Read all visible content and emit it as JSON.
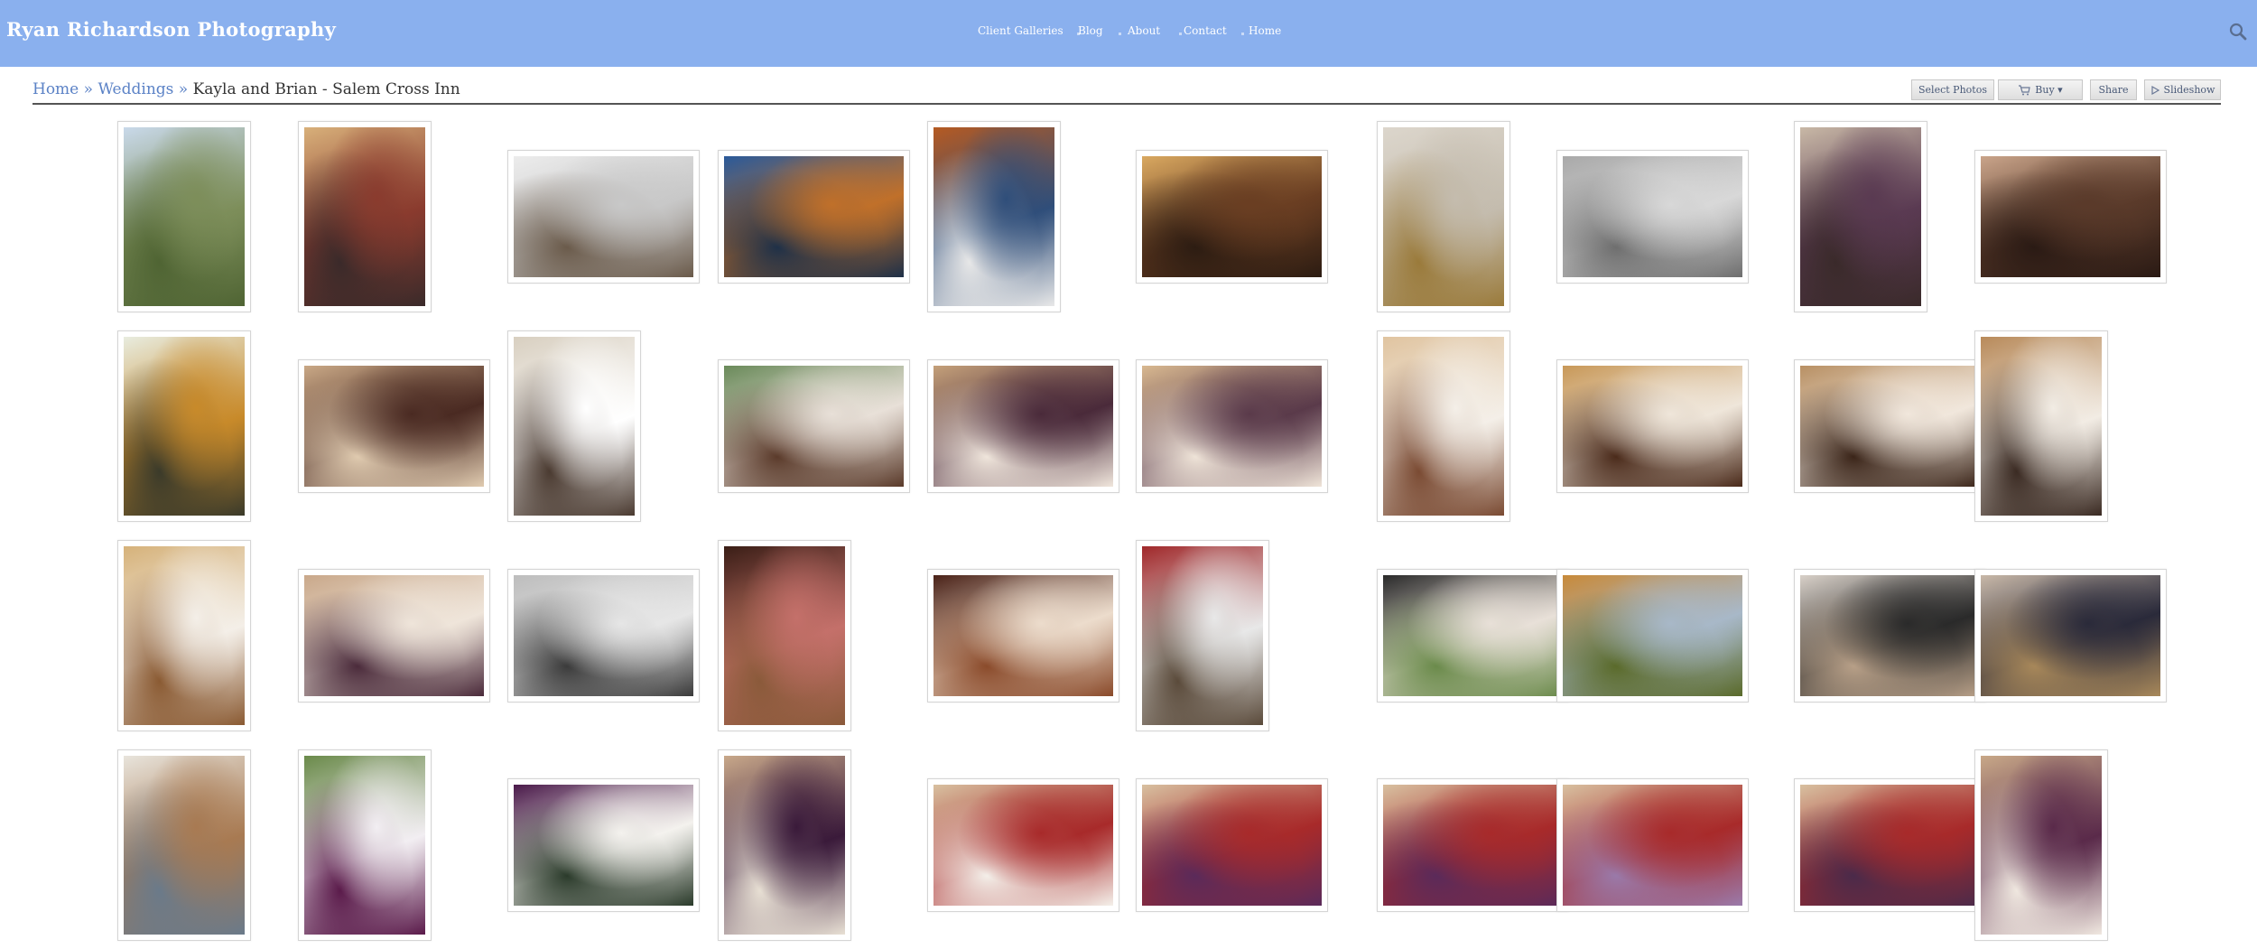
{
  "site": {
    "title": "Ryan Richardson Photography"
  },
  "nav": {
    "items": [
      {
        "label": "Client Galleries",
        "name": "nav-client-galleries"
      },
      {
        "label": "Blog",
        "name": "nav-blog"
      },
      {
        "label": "About",
        "name": "nav-about"
      },
      {
        "label": "Contact",
        "name": "nav-contact"
      },
      {
        "label": "Home",
        "name": "nav-home"
      }
    ]
  },
  "breadcrumb": {
    "home": "Home",
    "separator": "»",
    "section": "Weddings",
    "current": "Kayla and Brian - Salem Cross Inn"
  },
  "toolbar": {
    "select_label": "Select Photos",
    "buy_label": "Buy ▾",
    "share_label": "Share",
    "slideshow_label": "Slideshow"
  },
  "colors": {
    "header_bg": "#8ab0ee",
    "link": "#5b82c6",
    "thumb_border": "#d5d5d5"
  },
  "gallery": {
    "photos": [
      {
        "name": "photo-couple-field",
        "orientation": "portrait",
        "palette": [
          "#c9d9ea",
          "#7d8e5a",
          "#4f6433"
        ]
      },
      {
        "name": "photo-bride-makeup-chair",
        "orientation": "portrait",
        "palette": [
          "#d8b07a",
          "#8a3b2e",
          "#3a2a2a"
        ]
      },
      {
        "name": "photo-dress-detail",
        "orientation": "landscape",
        "palette": [
          "#ececec",
          "#c8c8c8",
          "#6a5a4a"
        ]
      },
      {
        "name": "photo-dress-by-lake",
        "orientation": "landscape",
        "palette": [
          "#2a5a9a",
          "#c0702a",
          "#1e3048"
        ]
      },
      {
        "name": "photo-dress-hanging-tree",
        "orientation": "portrait",
        "palette": [
          "#b55a22",
          "#2f4e7a",
          "#e8e8e8"
        ]
      },
      {
        "name": "photo-hair-pin",
        "orientation": "landscape",
        "palette": [
          "#d9a860",
          "#6a3e22",
          "#2c1c12"
        ]
      },
      {
        "name": "photo-necklace",
        "orientation": "portrait",
        "palette": [
          "#dcd6cc",
          "#c4bcae",
          "#9a7a3a"
        ]
      },
      {
        "name": "photo-silver-shoe",
        "orientation": "landscape",
        "palette": [
          "#a9a9a9",
          "#d8d8d8",
          "#6e6e6e"
        ]
      },
      {
        "name": "photo-braid-back",
        "orientation": "portrait",
        "palette": [
          "#c8b8a6",
          "#5a3a52",
          "#3a2a2a"
        ]
      },
      {
        "name": "photo-makeup-closeup",
        "orientation": "landscape",
        "palette": [
          "#c9a48a",
          "#5a3a2a",
          "#2a1a14"
        ]
      },
      {
        "name": "photo-bouquet-white",
        "orientation": "portrait",
        "palette": [
          "#e8ecdf",
          "#c88a2a",
          "#3a3a2a"
        ]
      },
      {
        "name": "photo-room-prep",
        "orientation": "landscape",
        "palette": [
          "#c9a886",
          "#4a2a22",
          "#e0cbb0"
        ]
      },
      {
        "name": "photo-bride-window",
        "orientation": "portrait",
        "palette": [
          "#d8cfc0",
          "#ffffff",
          "#4a3a30"
        ]
      },
      {
        "name": "photo-bride-dress-smile",
        "orientation": "landscape",
        "palette": [
          "#6a8a5a",
          "#e8e0d8",
          "#5a3a2a"
        ]
      },
      {
        "name": "photo-bridesmaid-help",
        "orientation": "landscape",
        "palette": [
          "#c4a07a",
          "#4a2a3a",
          "#f0e6dc"
        ]
      },
      {
        "name": "photo-dress-fitting",
        "orientation": "landscape",
        "palette": [
          "#d8b890",
          "#5a3a4a",
          "#efe4d8"
        ]
      },
      {
        "name": "photo-bride-portrait",
        "orientation": "portrait",
        "palette": [
          "#e0c4a0",
          "#f4efe8",
          "#7a4a32"
        ]
      },
      {
        "name": "photo-bride-laughing",
        "orientation": "landscape",
        "palette": [
          "#c89858",
          "#efe6da",
          "#4a2a1a"
        ]
      },
      {
        "name": "photo-bride-mother",
        "orientation": "landscape",
        "palette": [
          "#b89064",
          "#f1e7dc",
          "#3a2418"
        ]
      },
      {
        "name": "photo-bride-closeup",
        "orientation": "portrait",
        "palette": [
          "#b88a5a",
          "#f2ece4",
          "#3a2a22"
        ]
      },
      {
        "name": "photo-dress-back-mirror",
        "orientation": "portrait",
        "palette": [
          "#d6b27a",
          "#f4efe8",
          "#8a5a32"
        ]
      },
      {
        "name": "photo-lacing-dress",
        "orientation": "landscape",
        "palette": [
          "#c9a88a",
          "#efe5da",
          "#4a2a3a"
        ]
      },
      {
        "name": "photo-lace-bw",
        "orientation": "landscape",
        "palette": [
          "#bdbdbd",
          "#e6e6e6",
          "#3a3a3a"
        ]
      },
      {
        "name": "photo-hallway-pink",
        "orientation": "portrait",
        "palette": [
          "#3a1e16",
          "#c4706a",
          "#8a5a3a"
        ]
      },
      {
        "name": "photo-bride-at-table",
        "orientation": "landscape",
        "palette": [
          "#4a2218",
          "#ecdccc",
          "#8a4a2a"
        ]
      },
      {
        "name": "photo-limo-door",
        "orientation": "portrait",
        "palette": [
          "#a0282a",
          "#e8e8e8",
          "#5a4a3a"
        ]
      },
      {
        "name": "photo-bride-in-limo",
        "orientation": "landscape",
        "palette": [
          "#2a2a2a",
          "#e8e0d8",
          "#6a8a4a"
        ]
      },
      {
        "name": "photo-autumn-field",
        "orientation": "landscape",
        "palette": [
          "#c88a3a",
          "#a8b8c8",
          "#5a6a2a"
        ]
      },
      {
        "name": "photo-arrival-limo",
        "orientation": "landscape",
        "palette": [
          "#d8d0c8",
          "#2a2a2a",
          "#b8a088"
        ]
      },
      {
        "name": "photo-greeting-family",
        "orientation": "landscape",
        "palette": [
          "#c8b8a8",
          "#2a2a3a",
          "#a8885a"
        ]
      },
      {
        "name": "photo-bride-phone",
        "orientation": "portrait",
        "palette": [
          "#e8e4dc",
          "#a87a52",
          "#6a7a8a"
        ]
      },
      {
        "name": "photo-calla-lilies",
        "orientation": "portrait",
        "palette": [
          "#6a8a4a",
          "#f2eef2",
          "#5a1a4a"
        ]
      },
      {
        "name": "photo-bouquet-purple",
        "orientation": "landscape",
        "palette": [
          "#4a1a4a",
          "#f4f2ee",
          "#2a3a2a"
        ]
      },
      {
        "name": "photo-flowers-jar",
        "orientation": "portrait",
        "palette": [
          "#c8a88a",
          "#3a1a3a",
          "#e8e0d4"
        ]
      },
      {
        "name": "photo-bride-sofa",
        "orientation": "landscape",
        "palette": [
          "#d8c0a0",
          "#a82a2a",
          "#f4f0ea"
        ]
      },
      {
        "name": "photo-bride-bridesmaid-sofa",
        "orientation": "landscape",
        "palette": [
          "#d8c0a0",
          "#a82a2a",
          "#5a2a5a"
        ]
      },
      {
        "name": "photo-bride-two-maids",
        "orientation": "landscape",
        "palette": [
          "#d8c0a0",
          "#a82a2a",
          "#5a2a5a"
        ]
      },
      {
        "name": "photo-bride-maids-lilac",
        "orientation": "landscape",
        "palette": [
          "#d8c0a0",
          "#a82a2a",
          "#9a7aaa"
        ]
      },
      {
        "name": "photo-bridal-party-room",
        "orientation": "landscape",
        "palette": [
          "#d8c0a0",
          "#a82a2a",
          "#4a2a4a"
        ]
      },
      {
        "name": "photo-bridal-party-sofa",
        "orientation": "portrait",
        "palette": [
          "#c8a888",
          "#5a2a4a",
          "#f0e8e0"
        ]
      }
    ]
  }
}
